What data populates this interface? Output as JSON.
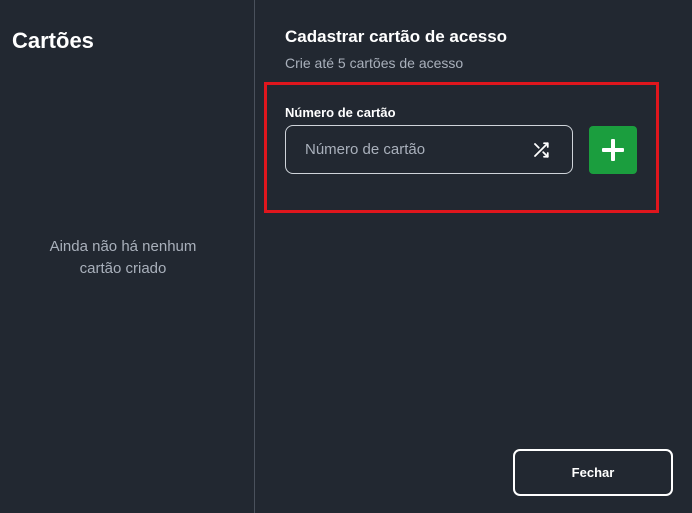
{
  "left": {
    "title": "Cartões",
    "empty_line1": "Ainda não há nenhum",
    "empty_line2": "cartão criado"
  },
  "form": {
    "title": "Cadastrar cartão de acesso",
    "subtitle": "Crie até 5 cartões de acesso",
    "field_label": "Número de cartão",
    "input_placeholder": "Número de cartão",
    "input_value": ""
  },
  "icons": {
    "shuffle": "shuffle-icon",
    "add": "plus-icon"
  },
  "actions": {
    "close_label": "Fechar"
  },
  "colors": {
    "background": "#222831",
    "accent_green": "#1b9e3e",
    "highlight_red": "#e0161d",
    "muted_text": "#a9b0bb"
  }
}
